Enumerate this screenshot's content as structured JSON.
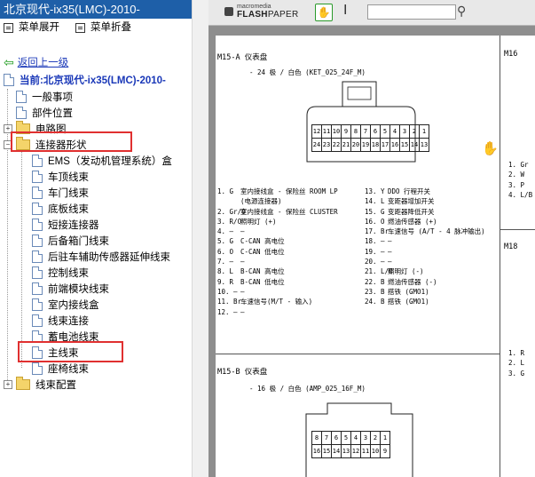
{
  "left_pane": {
    "title": "北京现代-ix35(LMC)-2010-",
    "toolbar": {
      "expand_label": "菜单展开",
      "collapse_label": "菜单折叠"
    },
    "back_label": "返回上一级",
    "current_label": "当前:北京现代-ix35(LMC)-2010-",
    "tree": [
      {
        "label": "一般事项",
        "icon": "doc-icon"
      },
      {
        "label": "部件位置",
        "icon": "doc-icon"
      },
      {
        "label": "电路图",
        "icon": "folder-icon"
      },
      {
        "label": "连接器形状",
        "icon": "folder-open-icon"
      },
      {
        "label": "EMS（发动机管理系统）盒",
        "icon": "doc-icon"
      },
      {
        "label": "车顶线束",
        "icon": "doc-icon"
      },
      {
        "label": "车门线束",
        "icon": "doc-icon"
      },
      {
        "label": "底板线束",
        "icon": "doc-icon"
      },
      {
        "label": "短接连接器",
        "icon": "doc-icon"
      },
      {
        "label": "后备箱门线束",
        "icon": "doc-icon"
      },
      {
        "label": "后驻车辅助传感器延伸线束",
        "icon": "doc-icon"
      },
      {
        "label": "控制线束",
        "icon": "doc-icon"
      },
      {
        "label": "前端模块线束",
        "icon": "doc-icon"
      },
      {
        "label": "室内接线盒",
        "icon": "doc-icon"
      },
      {
        "label": "线束连接",
        "icon": "doc-icon"
      },
      {
        "label": "蓄电池线束",
        "icon": "doc-icon"
      },
      {
        "label": "主线束",
        "icon": "doc-icon"
      },
      {
        "label": "座椅线束",
        "icon": "doc-icon"
      },
      {
        "label": "线束配置",
        "icon": "folder-icon"
      }
    ]
  },
  "viewer": {
    "brand_small": "macromedia",
    "brand_big": "FLASH",
    "brand_big2": "PAPER",
    "search_placeholder": "",
    "doc": {
      "m15a_title": "M15-A  仪表盘",
      "m15a_sub": "- 24 极 / 白色 (KET_025_24F_M)",
      "m15a_row1": [
        "12",
        "11",
        "10",
        "9",
        "8",
        "7",
        "6",
        "5",
        "4",
        "3",
        "2",
        "1"
      ],
      "m15a_row2": [
        "24",
        "23",
        "22",
        "21",
        "20",
        "19",
        "18",
        "17",
        "16",
        "15",
        "14",
        "13"
      ],
      "m15a_pins_left": [
        {
          "n": "1. G",
          "d": "室内接线盒 - 保险丝 ROOM LP"
        },
        {
          "n": "",
          "d": "(电源连接器)"
        },
        {
          "n": "2. Gr/O",
          "d": "室内接线盒 - 保险丝 CLUSTER"
        },
        {
          "n": "3. R/O",
          "d": "照明灯 (+)"
        },
        {
          "n": "4. —",
          "d": "—"
        },
        {
          "n": "5. G",
          "d": "C-CAN 高电位"
        },
        {
          "n": "6. O",
          "d": "C-CAN 低电位"
        },
        {
          "n": "7. —",
          "d": "—"
        },
        {
          "n": "8. L",
          "d": "B-CAN 高电位"
        },
        {
          "n": "9. R",
          "d": "B-CAN 低电位"
        },
        {
          "n": "10. —",
          "d": "—"
        },
        {
          "n": "11. Br",
          "d": "车速信号(M/T - 输入)"
        },
        {
          "n": "12. —",
          "d": "—"
        }
      ],
      "m15a_pins_right": [
        {
          "n": "13. Y",
          "d": "DDO 行程开关"
        },
        {
          "n": "14. L",
          "d": "变距器增加开关"
        },
        {
          "n": "15. G",
          "d": "变距器降低开关"
        },
        {
          "n": "16. O",
          "d": "燃油传感器 (+)"
        },
        {
          "n": "17. Br",
          "d": "车速信号 (A/T - 4 脉冲输出)"
        },
        {
          "n": "18. —",
          "d": "—"
        },
        {
          "n": "19. —",
          "d": "—"
        },
        {
          "n": "20. —",
          "d": "—"
        },
        {
          "n": "21. L/O",
          "d": "照明灯 (-)"
        },
        {
          "n": "22. B",
          "d": "燃油传感器 (-)"
        },
        {
          "n": "23. B",
          "d": "搭铁 (GMO1)"
        },
        {
          "n": "24. B",
          "d": "搭铁 (GMO1)"
        }
      ],
      "m15b_title": "M15-B  仪表盘",
      "m15b_sub": "- 16 极 / 白色 (AMP_025_16F_M)",
      "m15b_row1": [
        "8",
        "7",
        "6",
        "5",
        "4",
        "3",
        "2",
        "1"
      ],
      "m15b_row2": [
        "16",
        "15",
        "14",
        "13",
        "12",
        "11",
        "10",
        "9"
      ],
      "m16_title": "M16",
      "m16_pins": [
        "1. Gr",
        "2. W",
        "3. P",
        "4. L/B"
      ],
      "m18_title": "M18",
      "m18_pins": [
        "1. R",
        "2. L",
        "3. G"
      ]
    }
  },
  "colors": {
    "title_bar": "#1e5fa8",
    "highlight": "#e03030",
    "link": "#1a38b8"
  }
}
